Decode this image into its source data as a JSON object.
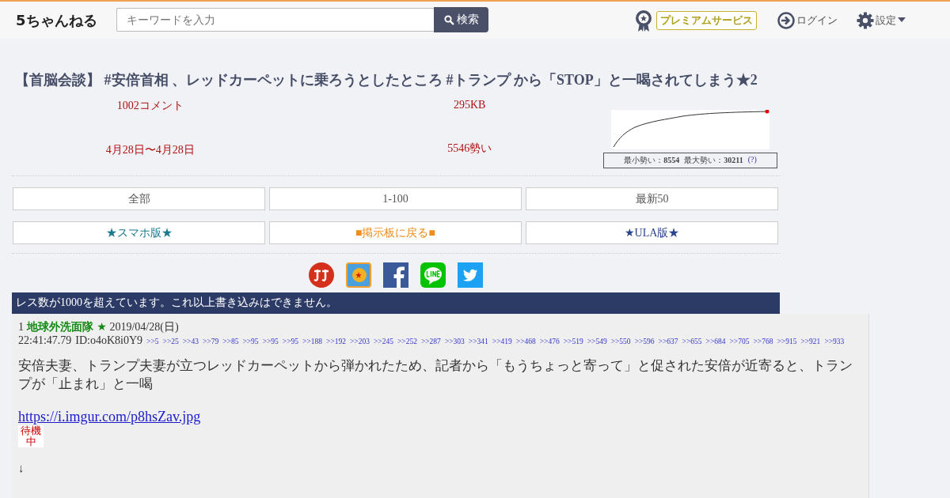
{
  "header": {
    "logo": "5ちゃんねる",
    "search": {
      "placeholder": "キーワードを入力",
      "button": "検索"
    },
    "premium": "プレミアムサービス",
    "login": "ログイン",
    "settings": "設定"
  },
  "thread": {
    "title": "【首脳会談】 #安倍首相 、レッドカーペットに乗ろうとしたところ #トランプ から「STOP」と一喝されてしまう★2",
    "comments": "1002コメント",
    "size": "295KB",
    "dates": "4月28日〜4月28日",
    "momentum": "5546勢い",
    "stats": {
      "min_label": "最小勢い：",
      "min": "8554",
      "max_label": "最大勢い：",
      "max": "30211",
      "help": "(?)"
    }
  },
  "nav": [
    {
      "label": "全部",
      "kind": "plain"
    },
    {
      "label": "1-100",
      "kind": "plain"
    },
    {
      "label": "最新50",
      "kind": "plain"
    },
    {
      "label": "★スマホ版★",
      "kind": "teal"
    },
    {
      "label": "■掲示板に戻る■",
      "kind": "orange"
    },
    {
      "label": "★ULA版★",
      "kind": "blue"
    }
  ],
  "notice": "レス数が1000を超えています。これ以上書き込みはできません。",
  "post": {
    "number": "1",
    "name": "地球外洗面隊 ★",
    "date": "2019/04/28(日)",
    "time": "22:41:47.79",
    "id": "ID:o4oK8i0Y9",
    "replies": [
      ">>5",
      ">>25",
      ">>43",
      ">>79",
      ">>85",
      ">>95",
      ">>95",
      ">>95",
      ">>188",
      ">>192",
      ">>203",
      ">>245",
      ">>252",
      ">>287",
      ">>303",
      ">>341",
      ">>419",
      ">>468",
      ">>476",
      ">>519",
      ">>549",
      ">>550",
      ">>596",
      ">>637",
      ">>655",
      ">>684",
      ">>705",
      ">>768",
      ">>915",
      ">>921",
      ">>933"
    ],
    "body": "安倍夫妻、トランプ夫妻が立つレッドカーペットから弾かれたため、記者から「もうちょっと寄って」と促された安倍が近寄ると、トランプが「止まれ」と一喝",
    "link": "https://i.imgur.com/p8hsZav.jpg",
    "badge": "待機中",
    "arrow": "↓"
  }
}
